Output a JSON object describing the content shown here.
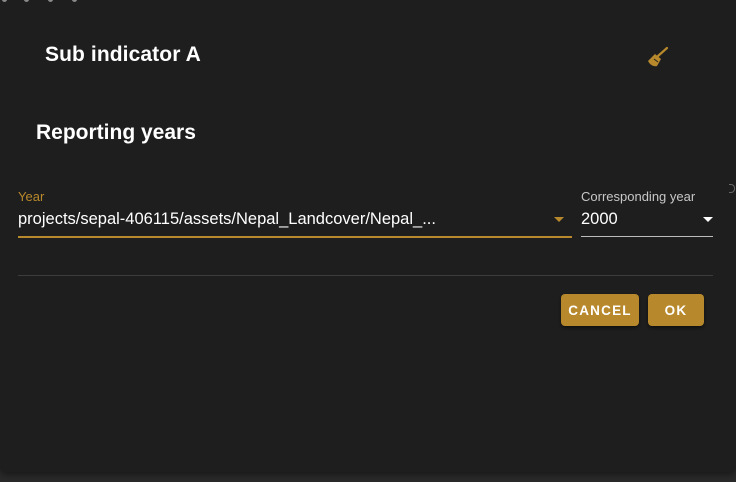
{
  "dialog": {
    "title": "Sub indicator A",
    "clear_icon": "broom-icon",
    "section_title": "Reporting years"
  },
  "year_field": {
    "label": "Year",
    "value": "projects/sepal-406115/assets/Nepal_Landcover/Nepal_..."
  },
  "corresponding_year_field": {
    "label": "Corresponding year",
    "value": "2000"
  },
  "actions": {
    "cancel_label": "CANCEL",
    "ok_label": "OK"
  },
  "colors": {
    "accent": "#b8892c",
    "background": "#1e1e1e",
    "text": "#ffffff"
  }
}
